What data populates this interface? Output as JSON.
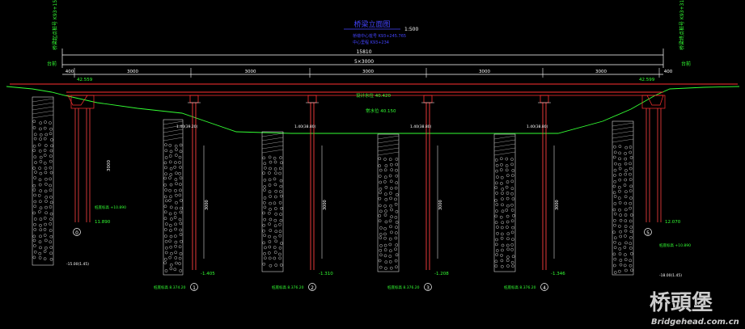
{
  "title": {
    "main": "桥梁立面图",
    "scale": "1:500",
    "sub1": "桥墩中心桩号 K93+245.765",
    "sub2": "中心里程 K93+234"
  },
  "stations": {
    "left": "桥梁起点桩号 K93+154.85",
    "right": "桥梁终点桩号 K93+313.85"
  },
  "dims": {
    "overall": "15810",
    "deck": "5×3000",
    "end_left": "400",
    "end_right": "400",
    "spans": [
      "3000",
      "3000",
      "3000",
      "3000",
      "3000"
    ]
  },
  "labels": {
    "left_end": "台前",
    "right_end": "台前",
    "deck_elev_left": "42.559",
    "deck_elev_right": "42.599",
    "design_water": "设计水位 40.420",
    "water_level": "常水位 40.150",
    "pile_len_left": "3000",
    "abut_elev_left": "11.890",
    "abut_elev_right": "12.070",
    "pile_bottom_left": "桩底标高 +10.890",
    "pile_bottom_right": "桩底标高 +10.890",
    "geo_left": "-15.00(1.45)",
    "geo_right": "-18.00(1.45)"
  },
  "piers": [
    {
      "id": "1",
      "cap_top": "1.40(39.20)",
      "pile_len": "3000",
      "tip": "-1.405",
      "bottom": "桩底标高 8.374.20"
    },
    {
      "id": "2",
      "cap_top": "1.40(38.80)",
      "pile_len": "3000",
      "tip": "-1.310",
      "bottom": "桩底标高 8.376.20"
    },
    {
      "id": "3",
      "cap_top": "1.40(38.80)",
      "pile_len": "3000",
      "tip": "-1.208",
      "bottom": "桩底标高 8.376.20"
    },
    {
      "id": "4",
      "cap_top": "1.40(38.80)",
      "pile_len": "3000",
      "tip": "-1.346",
      "bottom": "桩底标高 8.376.20"
    }
  ],
  "abutments": [
    {
      "id": "0"
    },
    {
      "id": "5"
    }
  ],
  "watermark": {
    "cn": "桥頭堡",
    "en": "Bridgehead.com.cn"
  },
  "colors": {
    "background": "#000000",
    "dimension": "#ffffff",
    "structure": "#ff3030",
    "pile": "#ff4040",
    "ground": "#33ff33",
    "text": "#33ff33",
    "title": "#4444ff"
  }
}
